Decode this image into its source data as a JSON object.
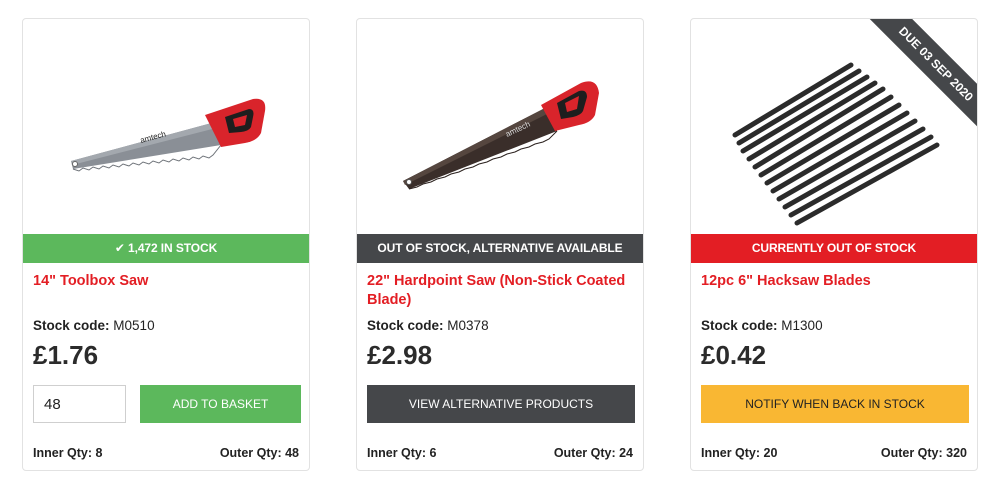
{
  "products": [
    {
      "status": "✔ 1,472 IN STOCK",
      "status_color": "#5cb85c",
      "title": "14\" Toolbox Saw",
      "stock_label": "Stock code:",
      "stock_code": "M0510",
      "price": "£1.76",
      "quantity_value": "48",
      "action_label": "ADD TO BASKET",
      "inner_qty": "Inner Qty: 8",
      "outer_qty": "Outer Qty: 48",
      "image_icon": "hand-saw-icon",
      "saw_brand": "amtech"
    },
    {
      "status": "OUT OF STOCK, ALTERNATIVE AVAILABLE",
      "status_color": "#45474a",
      "title": "22\" Hardpoint Saw (Non-Stick Coated Blade)",
      "stock_label": "Stock code:",
      "stock_code": "M0378",
      "price": "£2.98",
      "action_label": "VIEW ALTERNATIVE PRODUCTS",
      "inner_qty": "Inner Qty: 6",
      "outer_qty": "Outer Qty: 24",
      "image_icon": "hardpoint-saw-icon",
      "saw_brand": "amtech"
    },
    {
      "status": "CURRENTLY OUT OF STOCK",
      "status_color": "#e31e24",
      "title": "12pc 6\" Hacksaw Blades",
      "stock_label": "Stock code:",
      "stock_code": "M1300",
      "price": "£0.42",
      "action_label": "NOTIFY WHEN BACK IN STOCK",
      "inner_qty": "Inner Qty: 20",
      "outer_qty": "Outer Qty: 320",
      "ribbon": "DUE 03 SEP 2020",
      "image_icon": "hacksaw-blades-icon"
    }
  ],
  "colors": {
    "title_red": "#e31e24",
    "button_green": "#5cb85c",
    "button_dark": "#45474a",
    "button_amber": "#f9b733"
  }
}
